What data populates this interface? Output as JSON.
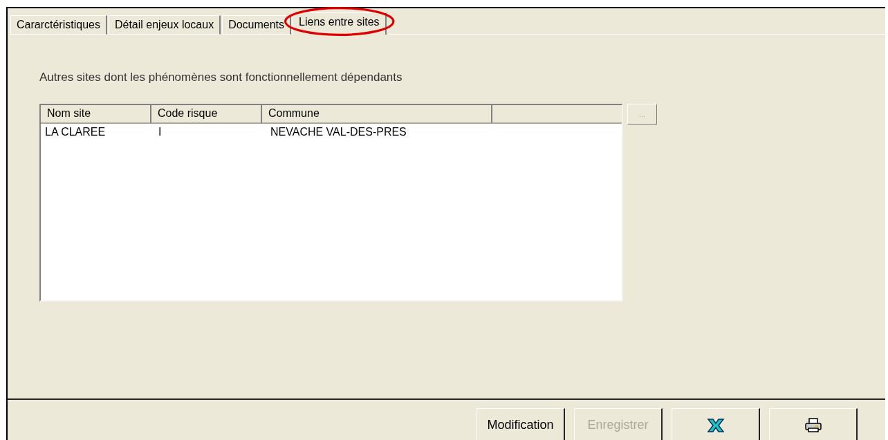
{
  "tabs": [
    {
      "label": "Cararctéristiques",
      "selected": false,
      "circled": false
    },
    {
      "label": "Détail enjeux locaux",
      "selected": false,
      "circled": false
    },
    {
      "label": "Documents",
      "selected": false,
      "circled": false
    },
    {
      "label": "Liens entre sites",
      "selected": true,
      "circled": true
    }
  ],
  "caption": "Autres sites dont les phénomènes sont fonctionnellement dépendants",
  "table": {
    "columns": [
      "Nom site",
      "Code risque",
      "Commune"
    ],
    "rows": [
      [
        "LA CLAREE",
        "I",
        "NEVACHE VAL-DES-PRES"
      ]
    ]
  },
  "browse_button": {
    "label": "...",
    "disabled": true
  },
  "buttons": [
    {
      "kind": "text",
      "label": "Modification",
      "disabled": false
    },
    {
      "kind": "text",
      "label": "Enregistrer",
      "disabled": true
    },
    {
      "kind": "excel",
      "disabled": false
    },
    {
      "kind": "print",
      "disabled": false
    }
  ]
}
